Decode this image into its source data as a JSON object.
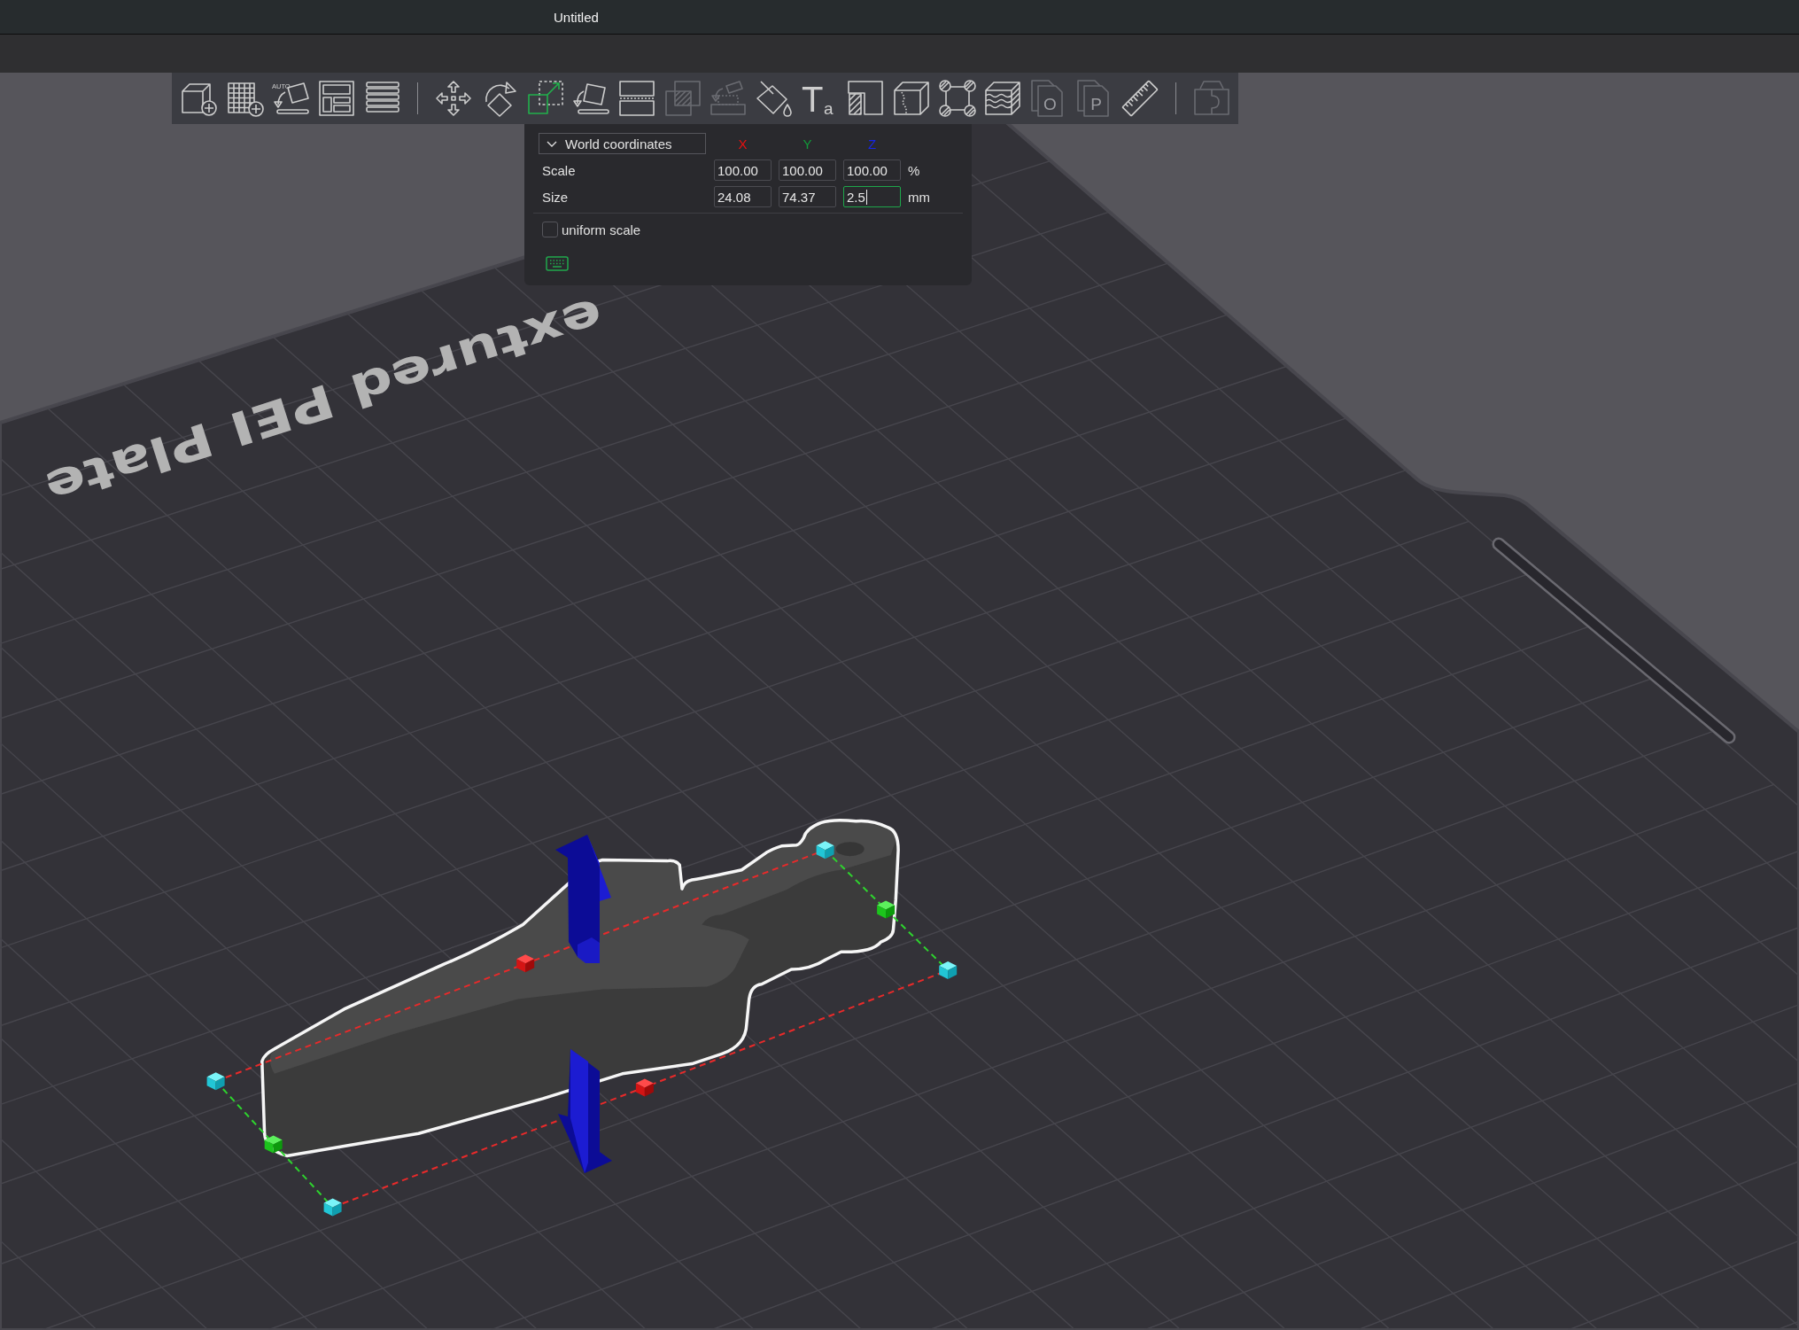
{
  "window": {
    "title": "Untitled"
  },
  "toolbar": {
    "groups": [
      [
        {
          "kind": "addpart",
          "selected": false,
          "disabled": false
        },
        {
          "kind": "addplate",
          "selected": false,
          "disabled": false
        },
        {
          "kind": "autoorient",
          "glyph": "AUTO",
          "selected": false,
          "disabled": false
        },
        {
          "kind": "arrange",
          "selected": false,
          "disabled": false
        },
        {
          "kind": "layers",
          "selected": false,
          "disabled": false
        }
      ],
      [
        {
          "kind": "move",
          "selected": false,
          "disabled": false
        },
        {
          "kind": "rotate",
          "selected": false,
          "disabled": false
        },
        {
          "kind": "scale",
          "selected": true,
          "disabled": false
        },
        {
          "kind": "layflat",
          "selected": false,
          "disabled": false
        },
        {
          "kind": "cut",
          "selected": false,
          "disabled": false
        },
        {
          "kind": "boolean",
          "selected": false,
          "disabled": true
        },
        {
          "kind": "support",
          "selected": false,
          "disabled": true
        },
        {
          "kind": "paint",
          "selected": false,
          "disabled": false
        },
        {
          "kind": "text",
          "glyph": "T",
          "glyph_small": "a",
          "selected": false,
          "disabled": false
        },
        {
          "kind": "seam",
          "selected": false,
          "disabled": false
        },
        {
          "kind": "crack",
          "selected": false,
          "disabled": false
        },
        {
          "kind": "corners",
          "selected": false,
          "disabled": false
        },
        {
          "kind": "fuzzy",
          "selected": false,
          "disabled": false
        },
        {
          "kind": "document",
          "glyph": "O",
          "selected": false,
          "disabled": true
        },
        {
          "kind": "document",
          "glyph": "P",
          "selected": false,
          "disabled": true
        },
        {
          "kind": "ruler",
          "selected": false,
          "disabled": false
        }
      ],
      [
        {
          "kind": "assembly",
          "selected": false,
          "disabled": true
        }
      ]
    ]
  },
  "scale_panel": {
    "coordinates": {
      "label": "World coordinates"
    },
    "axes": [
      {
        "label": "X",
        "color": "#e81010"
      },
      {
        "label": "Y",
        "color": "#119a3a"
      },
      {
        "label": "Z",
        "color": "#1626e8"
      }
    ],
    "rows": [
      {
        "label": "Scale",
        "unit": "%",
        "fields": [
          {
            "value": "100.00",
            "focused": false
          },
          {
            "value": "100.00",
            "focused": false
          },
          {
            "value": "100.00",
            "focused": false
          }
        ]
      },
      {
        "label": "Size",
        "unit": "mm",
        "fields": [
          {
            "value": "24.08",
            "focused": false
          },
          {
            "value": "74.37",
            "focused": false
          },
          {
            "value": "2.5",
            "focused": true
          }
        ]
      }
    ],
    "uniform_scale": {
      "label": "uniform scale",
      "checked": false
    }
  },
  "viewport": {
    "plate_label": "extured PEI Plate"
  }
}
